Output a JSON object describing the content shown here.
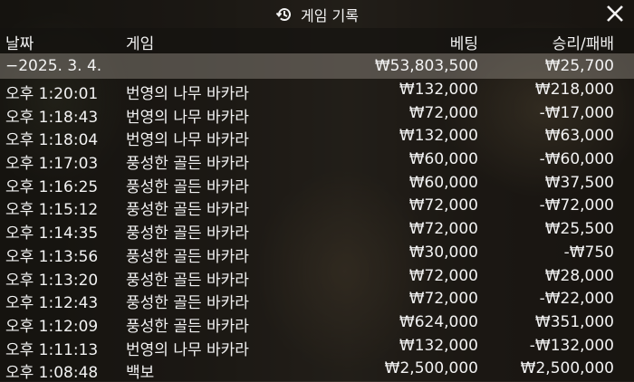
{
  "title": "게임 기록",
  "columns": {
    "date": "날짜",
    "game": "게임",
    "bet": "베팅",
    "result": "승리/패배"
  },
  "summary": {
    "date": "−2025. 3. 4.",
    "bet": "₩53,803,500",
    "result": "₩25,700"
  },
  "rows": [
    {
      "time": "오후 1:20:01",
      "game": "번영의 나무 바카라",
      "bet": "₩132,000",
      "result": "₩218,000"
    },
    {
      "time": "오후 1:18:43",
      "game": "번영의 나무 바카라",
      "bet": "₩72,000",
      "result": "-₩17,000"
    },
    {
      "time": "오후 1:18:04",
      "game": "번영의 나무 바카라",
      "bet": "₩132,000",
      "result": "₩63,000"
    },
    {
      "time": "오후 1:17:03",
      "game": "풍성한 골든 바카라",
      "bet": "₩60,000",
      "result": "-₩60,000"
    },
    {
      "time": "오후 1:16:25",
      "game": "풍성한 골든 바카라",
      "bet": "₩60,000",
      "result": "₩37,500"
    },
    {
      "time": "오후 1:15:12",
      "game": "풍성한 골든 바카라",
      "bet": "₩72,000",
      "result": "-₩72,000"
    },
    {
      "time": "오후 1:14:35",
      "game": "풍성한 골든 바카라",
      "bet": "₩72,000",
      "result": "₩25,500"
    },
    {
      "time": "오후 1:13:56",
      "game": "풍성한 골든 바카라",
      "bet": "₩30,000",
      "result": "-₩750"
    },
    {
      "time": "오후 1:13:20",
      "game": "풍성한 골든 바카라",
      "bet": "₩72,000",
      "result": "₩28,000"
    },
    {
      "time": "오후 1:12:43",
      "game": "풍성한 골든 바카라",
      "bet": "₩72,000",
      "result": "-₩22,000"
    },
    {
      "time": "오후 1:12:09",
      "game": "풍성한 골든 바카라",
      "bet": "₩624,000",
      "result": "₩351,000"
    },
    {
      "time": "오후 1:11:13",
      "game": "번영의 나무 바카라",
      "bet": "₩132,000",
      "result": "-₩132,000"
    },
    {
      "time": "오후 1:08:48",
      "game": "백보",
      "bet": "₩2,500,000",
      "result": "₩2,500,000"
    }
  ],
  "icons": {
    "title": "history-icon",
    "close": "close-icon"
  }
}
